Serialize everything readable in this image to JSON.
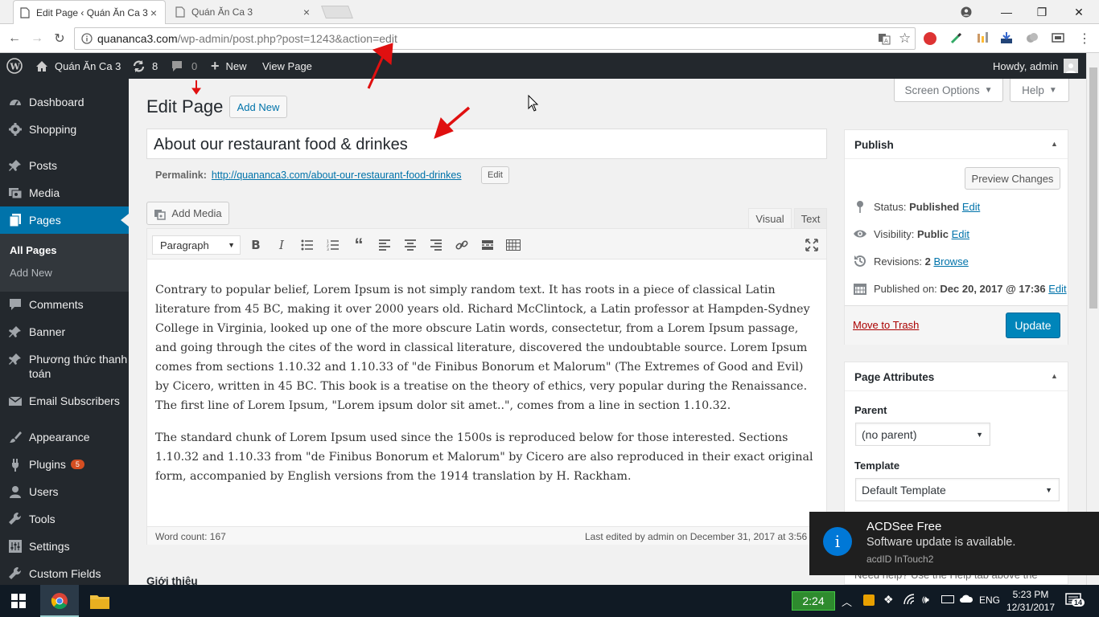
{
  "browser": {
    "tabs": [
      {
        "title": "Edit Page ‹ Quán Ăn Ca 3",
        "close": "×"
      },
      {
        "title": "Quán Ăn Ca 3",
        "close": "×"
      }
    ],
    "url_host": "quananca3.com",
    "url_path": "/wp-admin/post.php?post=1243&action=edit"
  },
  "adminbar": {
    "site_name": "Quán Ăn Ca 3",
    "updates_count": "8",
    "comments_count": "0",
    "new_label": "New",
    "view_page": "View Page",
    "howdy": "Howdy, admin"
  },
  "sidebar": {
    "items": [
      {
        "label": "Dashboard",
        "icon": "dashboard-icon"
      },
      {
        "label": "Shopping",
        "icon": "gear-icon"
      },
      {
        "label": "Posts",
        "icon": "pin-icon"
      },
      {
        "label": "Media",
        "icon": "media-icon"
      },
      {
        "label": "Pages",
        "icon": "pages-icon"
      },
      {
        "label": "Comments",
        "icon": "comment-icon"
      },
      {
        "label": "Banner",
        "icon": "pin-icon"
      },
      {
        "label": "Phương thức thanh toán",
        "icon": "pin-icon"
      },
      {
        "label": "Email Subscribers",
        "icon": "mail-icon"
      },
      {
        "label": "Appearance",
        "icon": "brush-icon"
      },
      {
        "label": "Plugins",
        "icon": "plug-icon",
        "badge": "5"
      },
      {
        "label": "Users",
        "icon": "user-icon"
      },
      {
        "label": "Tools",
        "icon": "wrench-icon"
      },
      {
        "label": "Settings",
        "icon": "settings-icon"
      },
      {
        "label": "Custom Fields",
        "icon": "wrench-icon"
      }
    ],
    "sub_all_pages": "All Pages",
    "sub_add_new": "Add New"
  },
  "screen_options": "Screen Options",
  "help": "Help",
  "page_heading": "Edit Page",
  "add_new_btn": "Add New",
  "post_title": "About our restaurant food & drinkes",
  "permalink_label": "Permalink:",
  "permalink_base": "http://quananca3.com/",
  "permalink_slug": "about-our-restaurant-food-drinkes",
  "permalink_edit": "Edit",
  "add_media": "Add Media",
  "tab_visual": "Visual",
  "tab_text": "Text",
  "format_select": "Paragraph",
  "content": {
    "p1": "Contrary to popular belief, Lorem Ipsum is not simply random text. It has roots in a piece of classical Latin literature from 45 BC, making it over 2000 years old. Richard McClintock, a Latin professor at Hampden-Sydney College in Virginia, looked up one of the more obscure Latin words, consectetur, from a Lorem Ipsum passage, and going through the cites of the word in classical literature, discovered the undoubtable source. Lorem Ipsum comes from sections 1.10.32 and 1.10.33 of \"de Finibus Bonorum et Malorum\" (The Extremes of Good and Evil) by Cicero, written in 45 BC. This book is a treatise on the theory of ethics, very popular during the Renaissance. The first line of Lorem Ipsum, \"Lorem ipsum dolor sit amet..\", comes from a line in section 1.10.32.",
    "p2": "The standard chunk of Lorem Ipsum used since the 1500s is reproduced below for those interested. Sections 1.10.32 and 1.10.33 from \"de Finibus Bonorum et Malorum\" by Cicero are also reproduced in their exact original form, accompanied by English versions from the 1914 translation by H. Rackham."
  },
  "word_count": "Word count: 167",
  "last_edited": "Last edited by admin on December 31, 2017 at 3:56 a",
  "next_section": "Giới thiệu",
  "publish": {
    "title": "Publish",
    "preview": "Preview Changes",
    "status_label": "Status:",
    "status_value": "Published",
    "visibility_label": "Visibility:",
    "visibility_value": "Public",
    "revisions_label": "Revisions:",
    "revisions_value": "2",
    "browse": "Browse",
    "published_label": "Published on:",
    "published_value": "Dec 20, 2017 @ 17:36",
    "edit": "Edit",
    "trash": "Move to Trash",
    "update": "Update"
  },
  "attributes": {
    "title": "Page Attributes",
    "parent_label": "Parent",
    "parent_value": "(no parent)",
    "template_label": "Template",
    "template_value": "Default Template",
    "help_text": "Need help? Use the Help tab above the"
  },
  "toast": {
    "title": "ACDSee Free",
    "message": "Software update is available.",
    "source": "acdID InTouch2"
  },
  "taskbar": {
    "timer": "2:24",
    "lang": "ENG",
    "time": "5:23 PM",
    "date": "12/31/2017",
    "notif_count": "14"
  },
  "colors": {
    "wp_blue": "#0073aa",
    "admin_dark": "#23282d",
    "arrow_red": "#e01010"
  }
}
